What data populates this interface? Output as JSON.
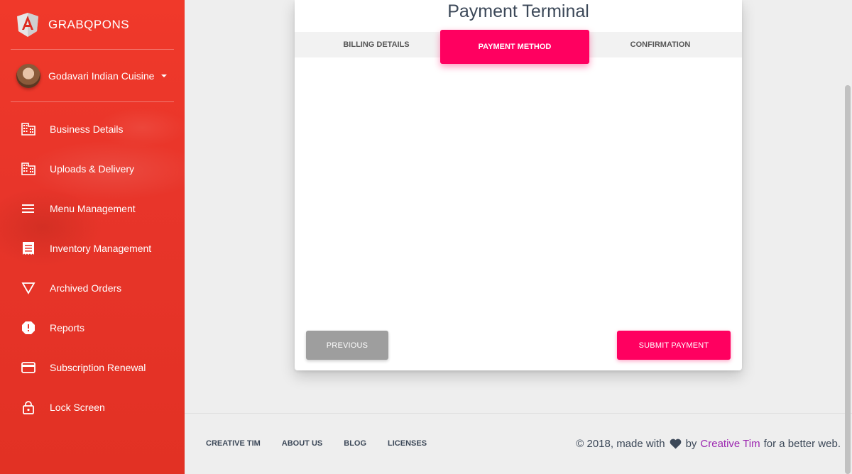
{
  "sidebar": {
    "brand": "GRABQPONS",
    "user_name": "Godavari Indian Cuisine",
    "items": [
      {
        "label": "Business Details",
        "icon": "building-icon"
      },
      {
        "label": "Uploads & Delivery",
        "icon": "building-icon"
      },
      {
        "label": "Menu Management",
        "icon": "menu-icon"
      },
      {
        "label": "Inventory Management",
        "icon": "receipt-icon"
      },
      {
        "label": "Archived Orders",
        "icon": "triangle-down-icon"
      },
      {
        "label": "Reports",
        "icon": "alert-icon"
      },
      {
        "label": "Subscription Renewal",
        "icon": "credit-card-icon"
      },
      {
        "label": "Lock Screen",
        "icon": "lock-icon"
      }
    ]
  },
  "card": {
    "title": "Payment Terminal",
    "tabs": [
      "BILLING DETAILS",
      "PAYMENT METHOD",
      "CONFIRMATION"
    ],
    "active_tab": "PAYMENT METHOD",
    "previous_label": "PREVIOUS",
    "submit_label": "SUBMIT PAYMENT"
  },
  "footer": {
    "links": [
      "CREATIVE TIM",
      "ABOUT US",
      "BLOG",
      "LICENSES"
    ],
    "copyright_prefix": "© 2018, made with",
    "copyright_by": "by",
    "copyright_link": "Creative Tim",
    "copyright_suffix": "for a better web."
  },
  "colors": {
    "sidebar": "#e8352a",
    "accent": "#ff0060",
    "link": "#9c27b0"
  }
}
